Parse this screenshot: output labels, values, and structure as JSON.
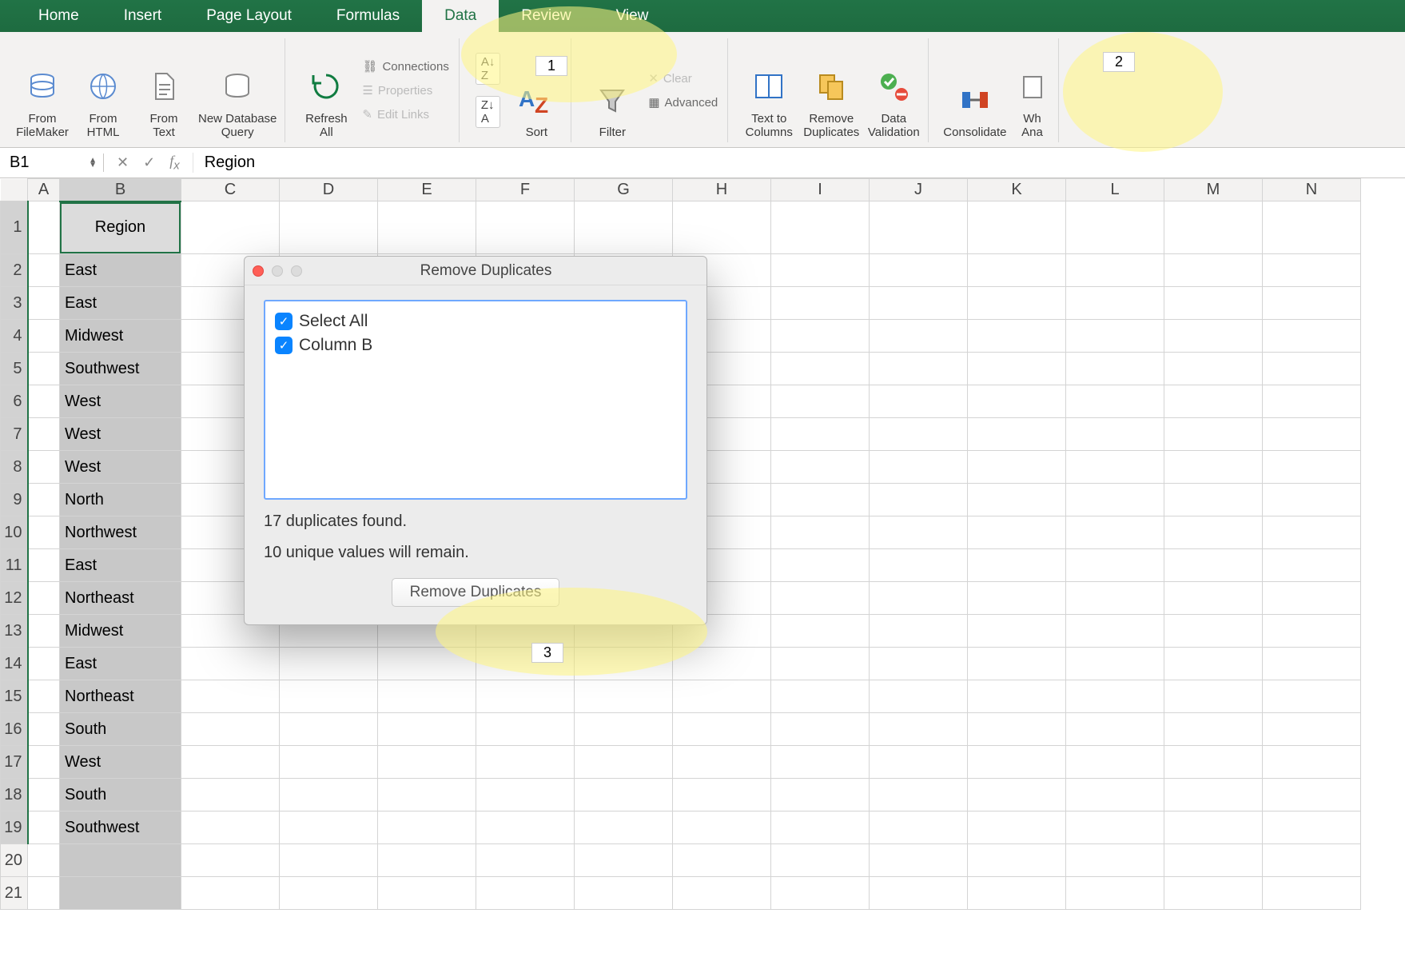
{
  "tabs": [
    "Home",
    "Insert",
    "Page Layout",
    "Formulas",
    "Data",
    "Review",
    "View"
  ],
  "active_tab": "Data",
  "ribbon": {
    "from_filemaker": "From\nFileMaker",
    "from_html": "From\nHTML",
    "from_text": "From\nText",
    "new_db_query": "New Database\nQuery",
    "refresh_all": "Refresh\nAll",
    "connections": "Connections",
    "properties": "Properties",
    "edit_links": "Edit Links",
    "sort": "Sort",
    "filter": "Filter",
    "clear": "Clear",
    "advanced": "Advanced",
    "text_to_columns": "Text to\nColumns",
    "remove_duplicates": "Remove\nDuplicates",
    "data_validation": "Data\nValidation",
    "consolidate": "Consolidate",
    "whatif": "Wh\nAna"
  },
  "name_box": "B1",
  "formula_value": "Region",
  "columns": [
    "A",
    "B",
    "C",
    "D",
    "E",
    "F",
    "G",
    "H",
    "I",
    "J",
    "K",
    "L",
    "M",
    "N"
  ],
  "row_count": 21,
  "header_cell": "Region",
  "col_b_values": [
    "East",
    "East",
    "Midwest",
    "Southwest",
    "West",
    "West",
    "West",
    "North",
    "Northwest",
    "East",
    "Northeast",
    "Midwest",
    "East",
    "Northeast",
    "South",
    "West",
    "South",
    "Southwest"
  ],
  "dialog": {
    "title": "Remove Duplicates",
    "select_all": "Select All",
    "column_b": "Column B",
    "dup_line": "17 duplicates found.",
    "unique_line": "10 unique values will remain.",
    "button": "Remove Duplicates"
  },
  "callouts": {
    "one": "1",
    "two": "2",
    "three": "3"
  }
}
